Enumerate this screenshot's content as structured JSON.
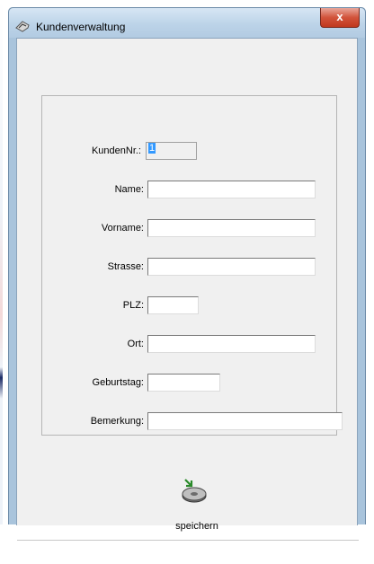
{
  "window": {
    "title": "Kundenverwaltung",
    "close_label": "x"
  },
  "form": {
    "kundennr": {
      "label": "KundenNr.:",
      "value": "1"
    },
    "name": {
      "label": "Name:",
      "value": ""
    },
    "vorname": {
      "label": "Vorname:",
      "value": ""
    },
    "strasse": {
      "label": "Strasse:",
      "value": ""
    },
    "plz": {
      "label": "PLZ:",
      "value": ""
    },
    "ort": {
      "label": "Ort:",
      "value": ""
    },
    "geburtstag": {
      "label": "Geburtstag:",
      "value": ""
    },
    "bemerkung": {
      "label": "Bemerkung:",
      "value": ""
    }
  },
  "actions": {
    "save_label": "speichern",
    "save_icon": "save-disk-icon"
  }
}
